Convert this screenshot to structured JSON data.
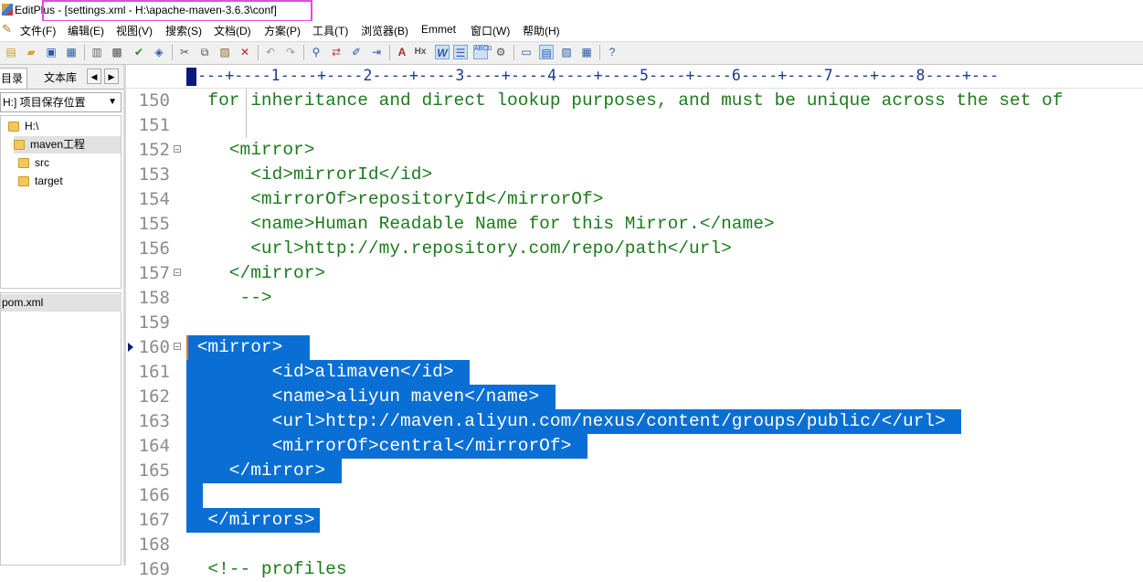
{
  "window": {
    "app_name": "EditPlus",
    "title": "EditPlus - [settings.xml - H:\\apache-maven-3.6.3\\conf]"
  },
  "menu": [
    {
      "label": "文件(F)"
    },
    {
      "label": "编辑(E)"
    },
    {
      "label": "视图(V)"
    },
    {
      "label": "搜索(S)"
    },
    {
      "label": "文档(D)"
    },
    {
      "label": "方案(P)"
    },
    {
      "label": "工具(T)"
    },
    {
      "label": "浏览器(B)"
    },
    {
      "label": "Emmet"
    },
    {
      "label": "窗口(W)"
    },
    {
      "label": "帮助(H)"
    }
  ],
  "toolbar": {
    "icons": [
      "new-file-icon",
      "open-folder-icon",
      "save-icon",
      "save-all-icon",
      "print-preview-icon",
      "print-icon",
      "spell-check-icon",
      "browser-icon",
      "cut-icon",
      "copy-icon",
      "paste-icon",
      "delete-icon",
      "undo-icon",
      "redo-icon",
      "find-icon",
      "replace-icon",
      "edit-icon",
      "goto-icon",
      "font-icon",
      "heading-icon",
      "word-wrap-icon",
      "line-number-icon",
      "ruler-icon",
      "settings-icon",
      "window-1-icon",
      "window-2-icon",
      "window-3-icon",
      "window-4-icon",
      "help-icon"
    ]
  },
  "left_panel": {
    "tabs": [
      {
        "label": "目录"
      },
      {
        "label": "文本库"
      }
    ],
    "prev_arrow": "◀",
    "next_arrow": "▶",
    "drive_select": "H:] 项目保存位置",
    "tree": [
      {
        "label": "H:\\"
      },
      {
        "label": "maven工程"
      },
      {
        "label": "src"
      },
      {
        "label": "target"
      }
    ],
    "files": [
      {
        "label": "pom.xml"
      }
    ]
  },
  "ruler": {
    "text": "---+----1----+----2----+----3----+----4----+----5----+----6----+----7----+----8----+---"
  },
  "editor": {
    "lines": [
      {
        "num": "150",
        "text": "  for inheritance and direct lookup purposes, and must be unique across the set of",
        "fold": false,
        "selected": false,
        "kind": "cmt"
      },
      {
        "num": "151",
        "text": "",
        "fold": false,
        "selected": false,
        "kind": "cmt"
      },
      {
        "num": "152",
        "text": "    <mirror>",
        "fold": true,
        "selected": false,
        "kind": "tag"
      },
      {
        "num": "153",
        "text": "      <id>mirrorId</id>",
        "fold": false,
        "selected": false,
        "kind": "tag"
      },
      {
        "num": "154",
        "text": "      <mirrorOf>repositoryId</mirrorOf>",
        "fold": false,
        "selected": false,
        "kind": "tag"
      },
      {
        "num": "155",
        "text": "      <name>Human Readable Name for this Mirror.</name>",
        "fold": false,
        "selected": false,
        "kind": "tag"
      },
      {
        "num": "156",
        "text": "      <url>http://my.repository.com/repo/path</url>",
        "fold": false,
        "selected": false,
        "kind": "tag"
      },
      {
        "num": "157",
        "text": "    </mirror>",
        "fold": true,
        "selected": false,
        "kind": "tag"
      },
      {
        "num": "158",
        "text": "     -->",
        "fold": false,
        "selected": false,
        "kind": "cmt"
      },
      {
        "num": "159",
        "text": "",
        "fold": false,
        "selected": false,
        "kind": "tag"
      },
      {
        "num": "160",
        "text": " <mirror>  ",
        "fold": true,
        "selected": true,
        "kind": "tag"
      },
      {
        "num": "161",
        "text": "        <id>alimaven</id> ",
        "fold": false,
        "selected": true,
        "kind": "tag"
      },
      {
        "num": "162",
        "text": "        <name>aliyun maven</name> ",
        "fold": false,
        "selected": true,
        "kind": "tag"
      },
      {
        "num": "163",
        "text": "        <url>http://maven.aliyun.com/nexus/content/groups/public/</url> ",
        "fold": false,
        "selected": true,
        "kind": "tag"
      },
      {
        "num": "164",
        "text": "        <mirrorOf>central</mirrorOf> ",
        "fold": false,
        "selected": true,
        "kind": "tag"
      },
      {
        "num": "165",
        "text": "    </mirror> ",
        "fold": false,
        "selected": true,
        "kind": "tag"
      },
      {
        "num": "166",
        "text": " ",
        "fold": false,
        "selected": true,
        "kind": "tag"
      },
      {
        "num": "167",
        "text": "  </mirrors>",
        "fold": false,
        "selected": true,
        "kind": "tag"
      },
      {
        "num": "168",
        "text": "",
        "fold": false,
        "selected": false,
        "kind": "tag"
      },
      {
        "num": "169",
        "text": "  <!-- profiles",
        "fold": false,
        "selected": false,
        "kind": "cmt"
      }
    ]
  }
}
